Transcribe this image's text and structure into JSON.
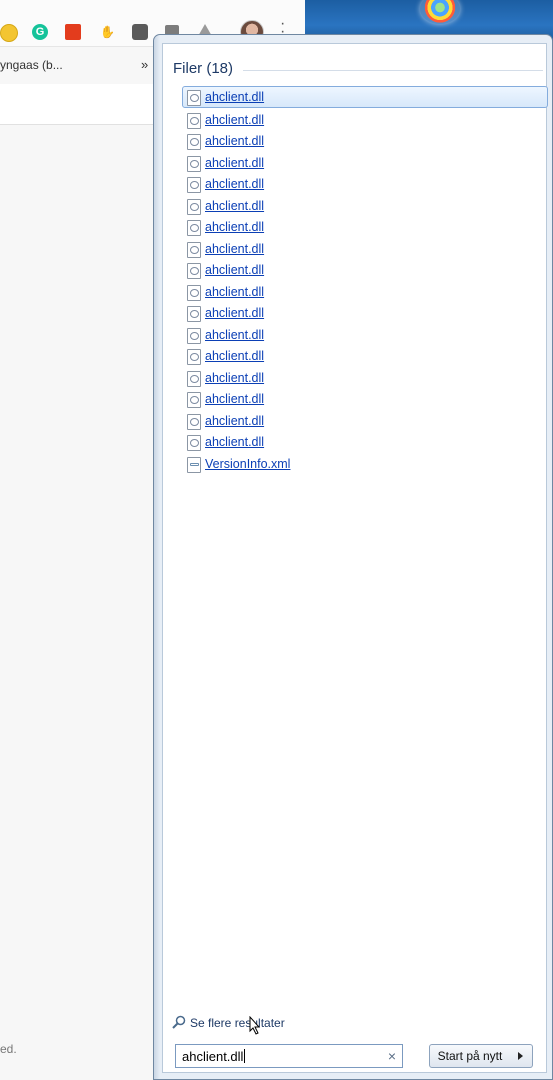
{
  "browser": {
    "bookmark_text": "yngaas (b...",
    "bookmark_overflow": "»",
    "footer_text": "ed."
  },
  "start_menu": {
    "section_header": "Filer (18)",
    "files": [
      "ahclient.dll",
      "ahclient.dll",
      "ahclient.dll",
      "ahclient.dll",
      "ahclient.dll",
      "ahclient.dll",
      "ahclient.dll",
      "ahclient.dll",
      "ahclient.dll",
      "ahclient.dll",
      "ahclient.dll",
      "ahclient.dll",
      "ahclient.dll",
      "ahclient.dll",
      "ahclient.dll",
      "ahclient.dll",
      "ahclient.dll",
      "VersionInfo.xml"
    ],
    "more_results": "Se flere resultater",
    "search_value": "ahclient.dll",
    "clear_icon": "×",
    "start_button": "Start på nytt"
  }
}
